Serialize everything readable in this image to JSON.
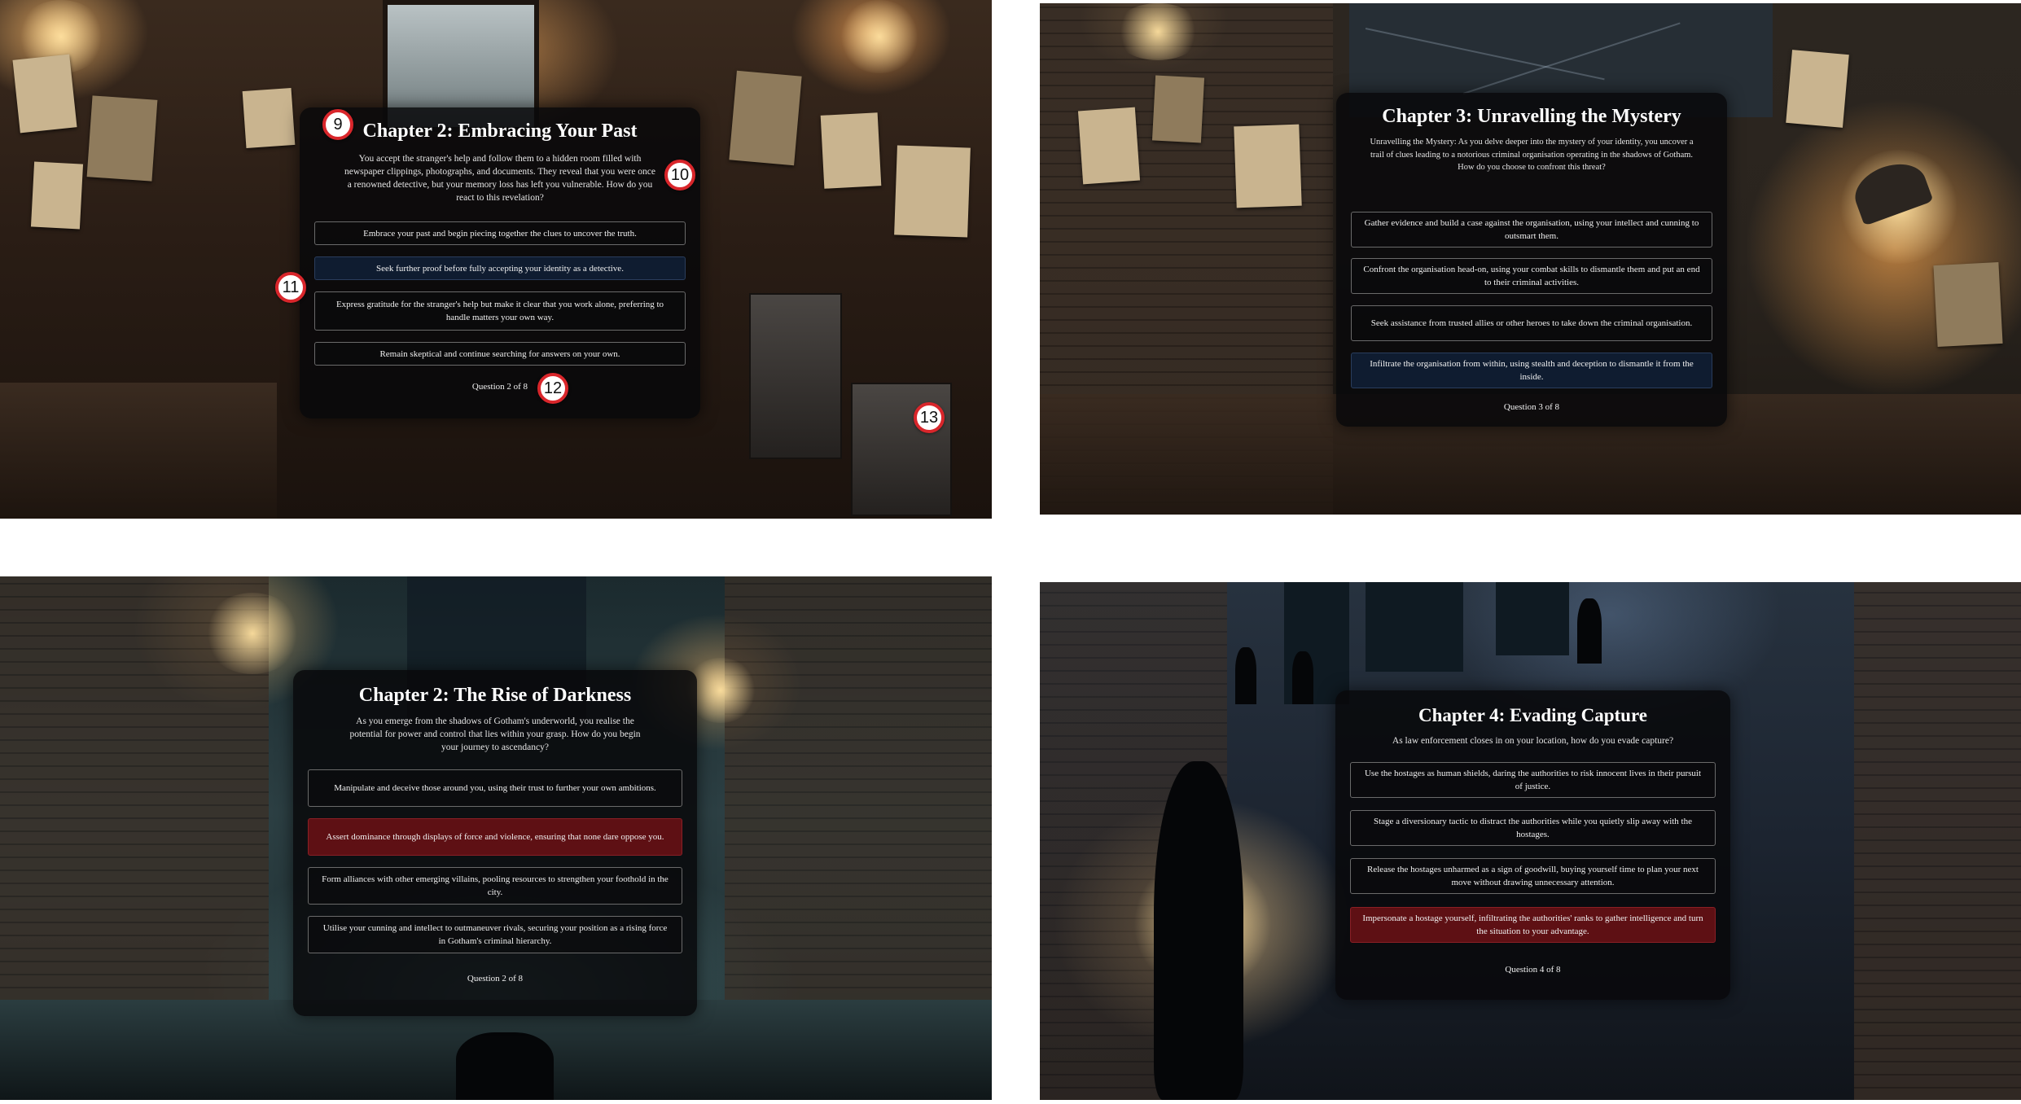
{
  "panels": [
    {
      "title": "Chapter 2: Embracing Your Past",
      "intro": "You accept the stranger's help and follow them to a hidden room filled with newspaper clippings, photographs, and documents. They reveal that you were once a renowned detective, but your memory loss has left you vulnerable. How do you react to this revelation?",
      "options": [
        "Embrace your past and begin piecing together the clues to uncover the truth.",
        "Seek further proof before fully accepting your identity as a detective.",
        "Express gratitude for the stranger's help but make it clear that you work alone, preferring to handle matters your own way.",
        "Remain skeptical and continue searching for answers on your own."
      ],
      "selected_index": 1,
      "selected_color": "#0f1c30",
      "question_counter": "Question 2 of 8",
      "markers": [
        "9",
        "10",
        "11",
        "12",
        "13"
      ]
    },
    {
      "title": "Chapter 3: Unravelling the Mystery",
      "intro": "Unravelling the Mystery: As you delve deeper into the mystery of your identity, you uncover a trail of clues leading to a notorious criminal organisation operating in the shadows of Gotham. How do you choose to confront this threat?",
      "options": [
        "Gather evidence and build a case against the organisation, using your intellect and cunning to outsmart them.",
        "Confront the organisation head-on, using your combat skills to dismantle them and put an end to their criminal activities.",
        "Seek assistance from trusted allies or other heroes to take down the criminal organisation.",
        "Infiltrate the organisation from within, using stealth and deception to dismantle it from the inside."
      ],
      "selected_index": 3,
      "selected_color": "#0f1c30",
      "question_counter": "Question 3 of 8"
    },
    {
      "title": "Chapter 2: The Rise of Darkness",
      "intro": "As you emerge from the shadows of Gotham's underworld, you realise the potential for power and control that lies within your grasp. How do you begin your journey to ascendancy?",
      "options": [
        "Manipulate and deceive those around you, using their trust to further your own ambitions.",
        "Assert dominance through displays of force and violence, ensuring that none dare oppose you.",
        "Form alliances with other emerging villains, pooling resources to strengthen your foothold in the city.",
        "Utilise your cunning and intellect to outmaneuver rivals, securing your position as a rising force in Gotham's criminal hierarchy."
      ],
      "selected_index": 1,
      "selected_color": "#5e1014",
      "question_counter": "Question 2 of 8"
    },
    {
      "title": "Chapter 4: Evading Capture",
      "intro": "As law enforcement closes in on your location, how do you evade capture?",
      "options": [
        "Use the hostages as human shields, daring the authorities to risk innocent lives in their pursuit of justice.",
        "Stage a diversionary tactic to distract the authorities while you quietly slip away with the hostages.",
        "Release the hostages unharmed as a sign of goodwill, buying yourself time to plan your next move without drawing unnecessary attention.",
        "Impersonate a hostage yourself, infiltrating the authorities' ranks to gather intelligence and turn the situation to your advantage."
      ],
      "selected_index": 3,
      "selected_color": "#5e1014",
      "question_counter": "Question 4 of 8"
    }
  ]
}
